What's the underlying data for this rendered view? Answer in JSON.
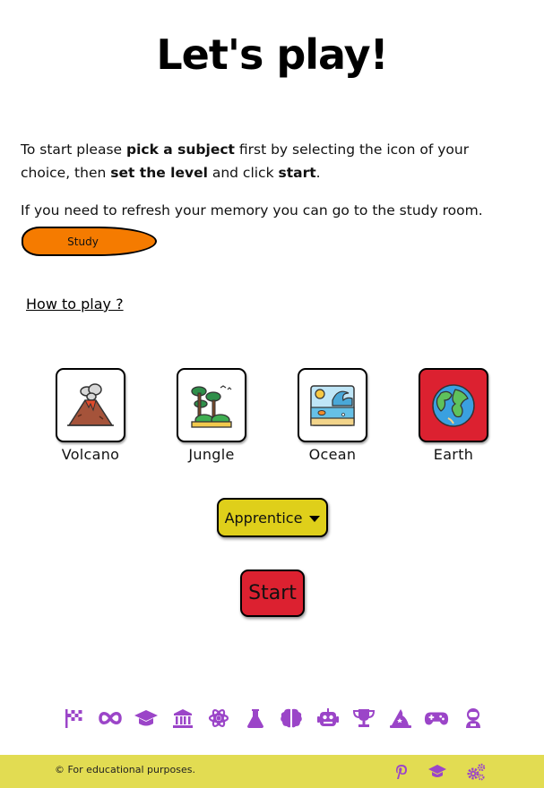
{
  "title": "Let's play!",
  "intro": {
    "p1_a": "To start please ",
    "p1_b": "pick a subject",
    "p1_c": " first by selecting the icon of your choice, then ",
    "p1_d": "set the level",
    "p1_e": " and click ",
    "p1_f": "start",
    "p1_g": ".",
    "p2": "If you need to refresh your memory you can go to the study room."
  },
  "study_button": "Study",
  "how_to_play": "How to play ?",
  "subjects": [
    {
      "label": "Volcano",
      "icon": "volcano-icon",
      "selected": false
    },
    {
      "label": "Jungle",
      "icon": "jungle-icon",
      "selected": false
    },
    {
      "label": "Ocean",
      "icon": "ocean-icon",
      "selected": false
    },
    {
      "label": "Earth",
      "icon": "earth-icon",
      "selected": true
    }
  ],
  "level": {
    "selected": "Apprentice"
  },
  "start_button": "Start",
  "bottom_icons": [
    "checkered-flag-icon",
    "infinity-icon",
    "graduation-cap-icon",
    "museum-icon",
    "atom-icon",
    "flask-icon",
    "brain-icon",
    "robot-icon",
    "trophy-icon",
    "wizard-hat-icon",
    "gamepad-icon",
    "astronaut-icon"
  ],
  "footer": {
    "copyright": "© For educational purposes.",
    "icons": [
      "pinterest-icon",
      "graduation-cap-icon",
      "gears-icon"
    ]
  },
  "colors": {
    "accent_purple": "#9b45c8",
    "study_orange": "#f57b00",
    "level_yellow": "#dfcf1a",
    "start_red": "#dc2130",
    "footer_yellow": "#e2dc52"
  }
}
